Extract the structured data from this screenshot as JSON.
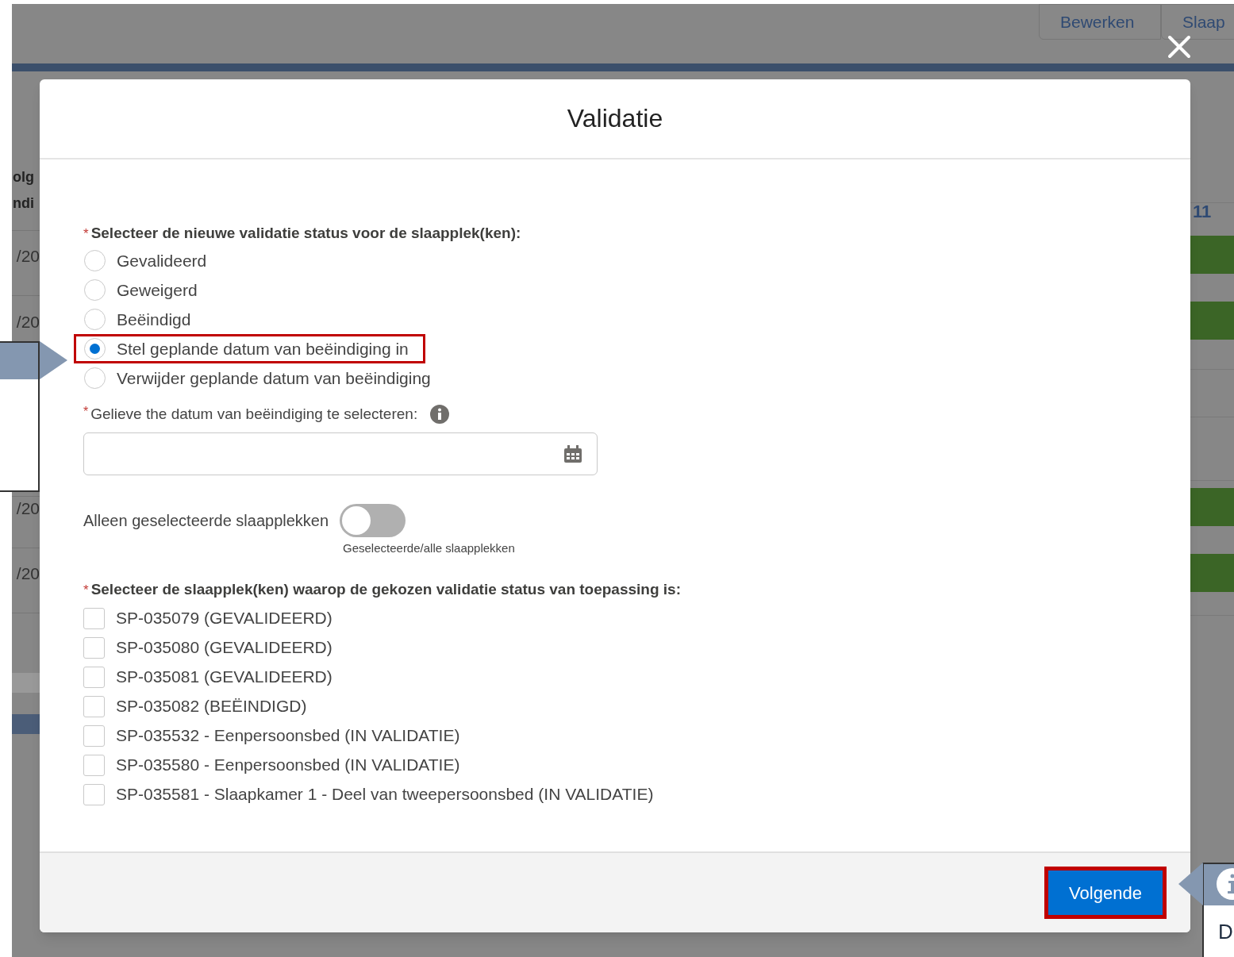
{
  "background": {
    "tabs": [
      {
        "label": "Bewerken"
      },
      {
        "label": "Slaap"
      }
    ],
    "column_header_lines": [
      "olg",
      "ndi"
    ],
    "date_cells": [
      "/20",
      "/20",
      "/20",
      "/20"
    ],
    "day_header": "11"
  },
  "modal": {
    "title": "Validatie",
    "status_question": {
      "asterisk": "*",
      "label": "Selecteer de nieuwe validatie status voor de slaapplek(ken):"
    },
    "status_options": [
      {
        "label": "Gevalideerd",
        "selected": false,
        "highlighted": false
      },
      {
        "label": "Geweigerd",
        "selected": false,
        "highlighted": false
      },
      {
        "label": "Beëindigd",
        "selected": false,
        "highlighted": false
      },
      {
        "label": "Stel geplande datum van beëindiging in",
        "selected": true,
        "highlighted": true
      },
      {
        "label": "Verwijder geplande datum van beëindiging",
        "selected": false,
        "highlighted": false
      }
    ],
    "date_field": {
      "asterisk": "*",
      "label": "Gelieve the datum van beëindiging te selecteren:"
    },
    "toggle": {
      "label": "Alleen geselecteerde slaapplekken",
      "on": false,
      "caption": "Geselecteerde/alle slaapplekken"
    },
    "places_question": {
      "asterisk": "*",
      "label": "Selecteer de slaapplek(ken) waarop de gekozen validatie status van toepassing is:"
    },
    "places": [
      {
        "label": "SP-035079 (GEVALIDEERD)",
        "checked": false
      },
      {
        "label": "SP-035080 (GEVALIDEERD)",
        "checked": false
      },
      {
        "label": "SP-035081 (GEVALIDEERD)",
        "checked": false
      },
      {
        "label": "SP-035082 (BEËINDIGD)",
        "checked": false
      },
      {
        "label": "SP-035532 - Eenpersoonsbed (IN VALIDATIE)",
        "checked": false
      },
      {
        "label": "SP-035580 - Eenpersoonsbed (IN VALIDATIE)",
        "checked": false
      },
      {
        "label": "SP-035581 - Slaapkamer 1 - Deel van tweepersoonsbed (IN VALIDATIE)",
        "checked": false
      }
    ],
    "next_button": {
      "label": "Volgende",
      "highlighted": true
    }
  },
  "callouts": [
    {
      "kind": "left"
    },
    {
      "kind": "right",
      "text": "D"
    }
  ]
}
